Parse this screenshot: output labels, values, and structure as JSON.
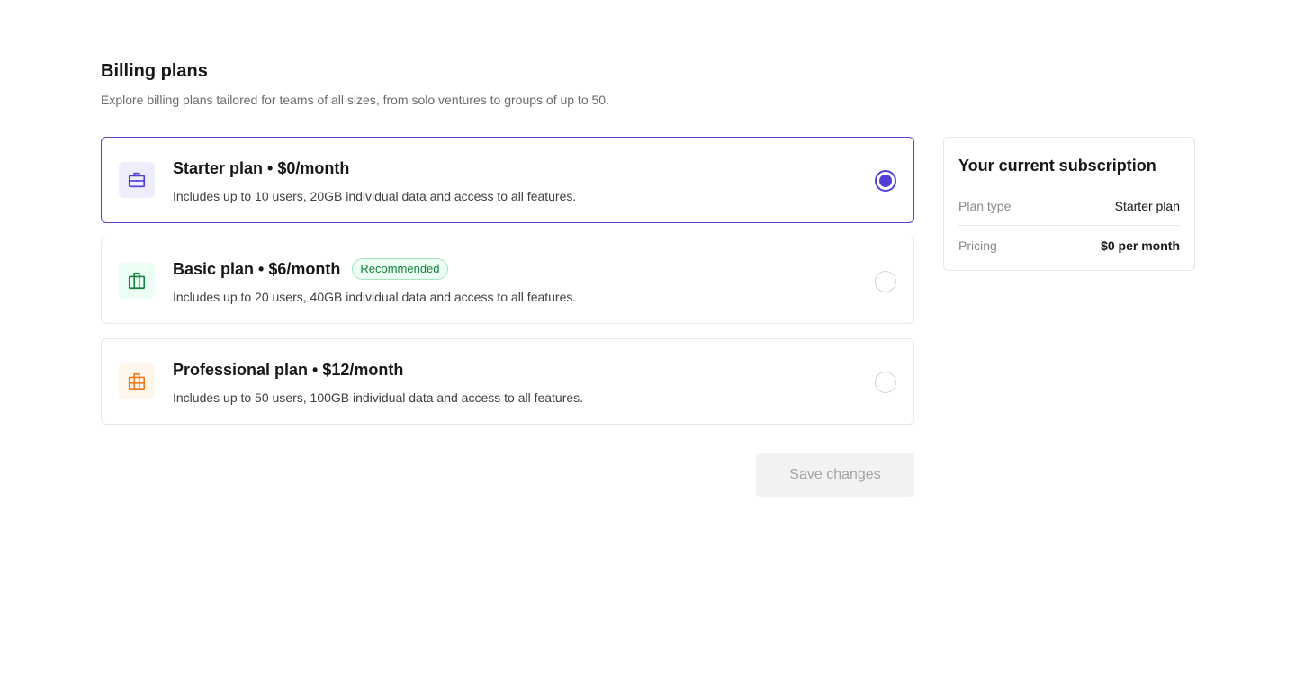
{
  "header": {
    "title": "Billing plans",
    "subtitle": "Explore billing plans tailored for teams of all sizes, from solo ventures to groups of up to 50."
  },
  "plans": [
    {
      "name": "Starter plan • $0/month",
      "description": "Includes up to 10 users, 20GB individual data and access to all features.",
      "badge": "",
      "icon": "briefcase-icon",
      "icon_color": "#4f3fd6",
      "icon_bg": "#eeedfb",
      "selected": true
    },
    {
      "name": "Basic plan • $6/month",
      "description": "Includes up to 20 users, 40GB individual data and access to all features.",
      "badge": "Recommended",
      "icon": "luggage-icon",
      "icon_color": "#15803d",
      "icon_bg": "#ecfdf3",
      "selected": false
    },
    {
      "name": "Professional plan • $12/month",
      "description": "Includes up to 50 users, 100GB individual data and access to all features.",
      "badge": "",
      "icon": "building-icon",
      "icon_color": "#ea7a1a",
      "icon_bg": "#fff6ec",
      "selected": false
    }
  ],
  "save_button": {
    "label": "Save changes",
    "disabled": true
  },
  "subscription": {
    "title": "Your current subscription",
    "rows": [
      {
        "label": "Plan type",
        "value": "Starter plan"
      },
      {
        "label": "Pricing",
        "value": "$0 per month"
      }
    ]
  },
  "colors": {
    "accent": "#4f3fd6",
    "selected_border": "#5b3fc4",
    "badge_green": "#15803d"
  }
}
